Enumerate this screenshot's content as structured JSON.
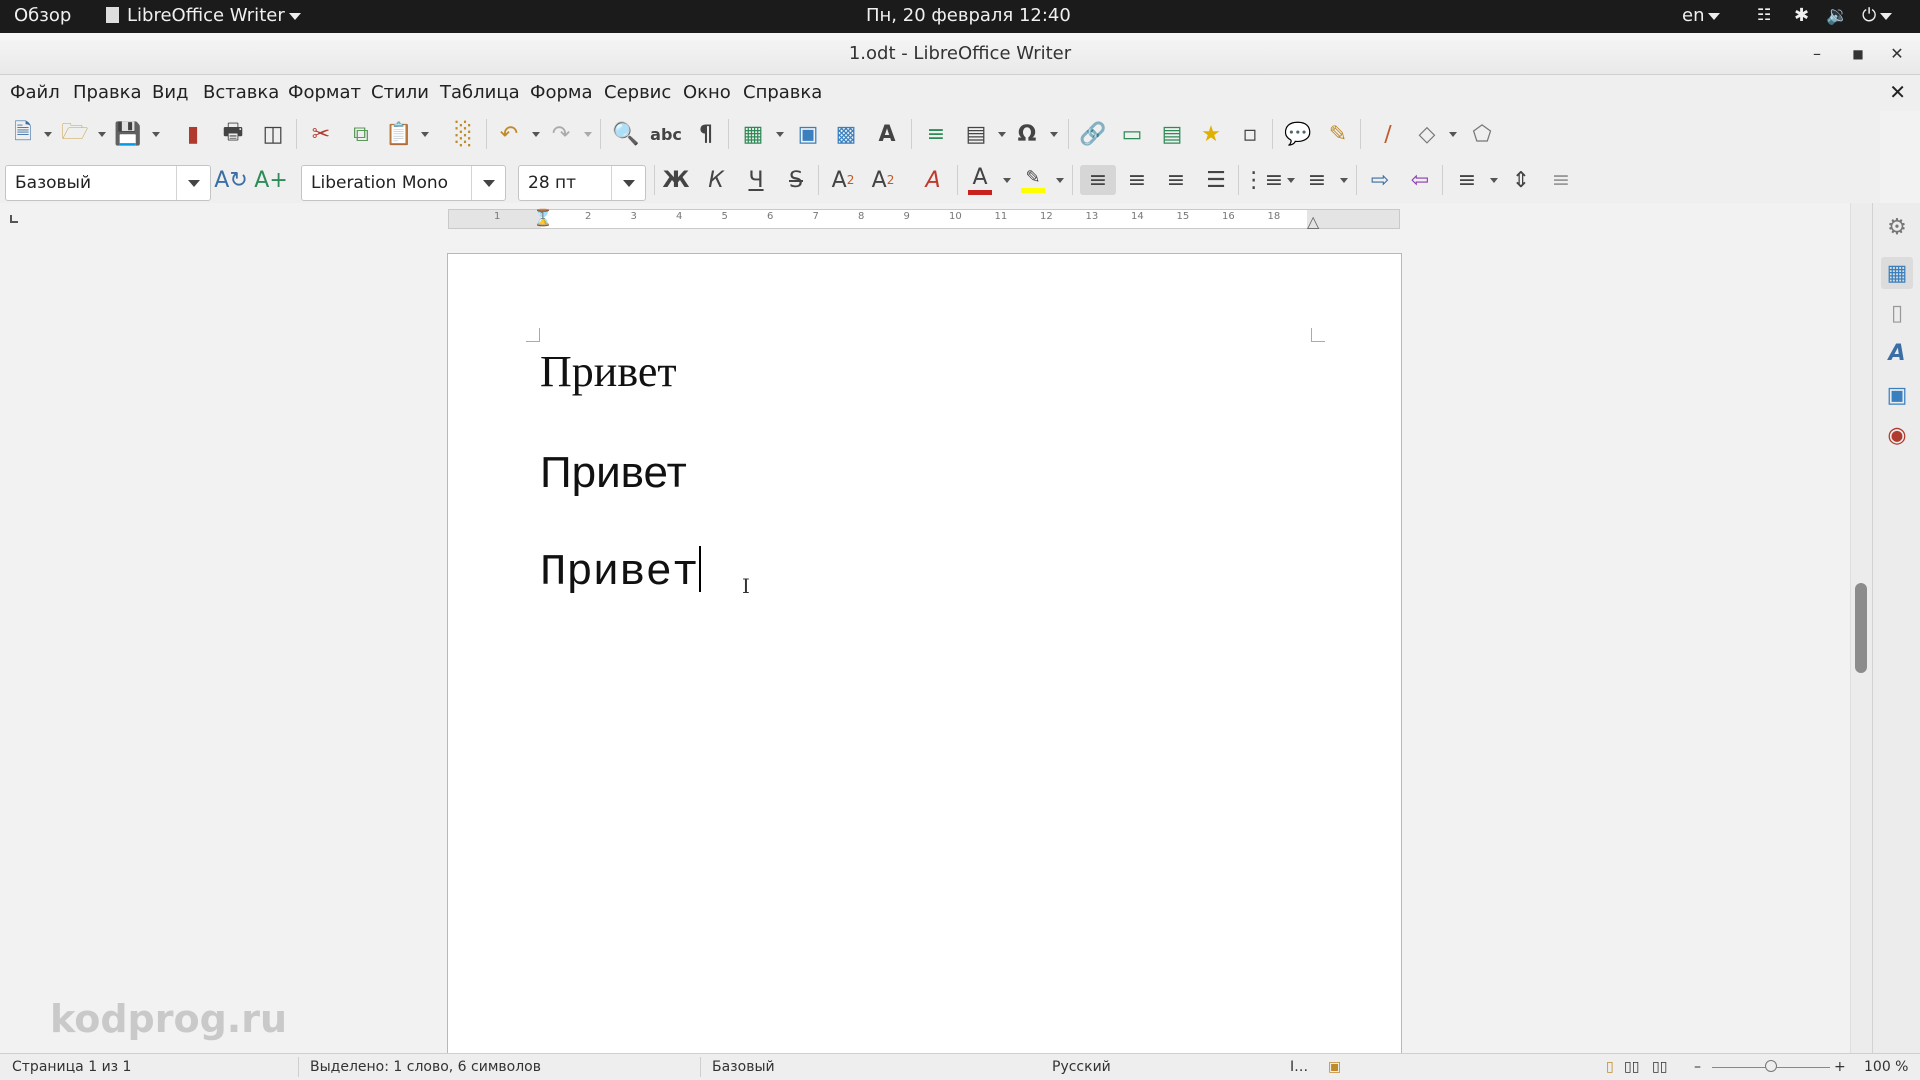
{
  "topbar": {
    "activities": "Обзор",
    "app_name": "LibreOffice Writer",
    "datetime": "Пн, 20 февраля  12:40",
    "lang": "en"
  },
  "window": {
    "title": "1.odt - LibreOffice Writer"
  },
  "menu": {
    "items": [
      "Файл",
      "Правка",
      "Вид",
      "Вставка",
      "Формат",
      "Стили",
      "Таблица",
      "Форма",
      "Сервис",
      "Окно",
      "Справка"
    ]
  },
  "formatting": {
    "paragraph_style": "Базовый",
    "font_name": "Liberation Mono",
    "font_size": "28 пт",
    "bold_label": "Ж",
    "italic_label": "К",
    "underline_label": "Ч"
  },
  "ruler": {
    "ticks": [
      "1",
      "1",
      "2",
      "3",
      "4",
      "5",
      "6",
      "7",
      "8",
      "9",
      "10",
      "11",
      "12",
      "13",
      "14",
      "15",
      "16",
      "18"
    ]
  },
  "document": {
    "paragraphs": [
      "Привет",
      "Привет",
      "Привет"
    ]
  },
  "watermark": "kodprog.ru",
  "statusbar": {
    "page": "Страница 1 из 1",
    "selection": "Выделено: 1 слово, 6 символов",
    "style": "Базовый",
    "language": "Русский",
    "zoom": "100 %"
  },
  "colors": {
    "font_color": "#c9211e",
    "highlight_color": "#ffff00",
    "topbar_bg": "#1b1b1b"
  },
  "icons": {
    "toolbar1": [
      "new-document-icon",
      "open-icon",
      "save-icon",
      "export-pdf-icon",
      "print-icon",
      "print-preview-icon",
      "cut-icon",
      "copy-icon",
      "paste-icon",
      "clone-formatting-icon",
      "undo-icon",
      "redo-icon",
      "find-replace-icon",
      "spellcheck-icon",
      "formatting-marks-icon",
      "insert-table-icon",
      "insert-image-icon",
      "insert-chart-icon",
      "insert-textbox-icon",
      "page-break-icon",
      "insert-field-icon",
      "special-character-icon",
      "hyperlink-icon",
      "footnote-icon",
      "endnote-icon",
      "bookmark-icon",
      "cross-reference-icon",
      "comment-icon",
      "track-changes-icon",
      "line-icon",
      "basic-shapes-icon",
      "polygon-icon"
    ],
    "sidebar": [
      "properties-icon",
      "page-icon",
      "styles-icon",
      "gallery-icon",
      "navigator-icon"
    ]
  }
}
